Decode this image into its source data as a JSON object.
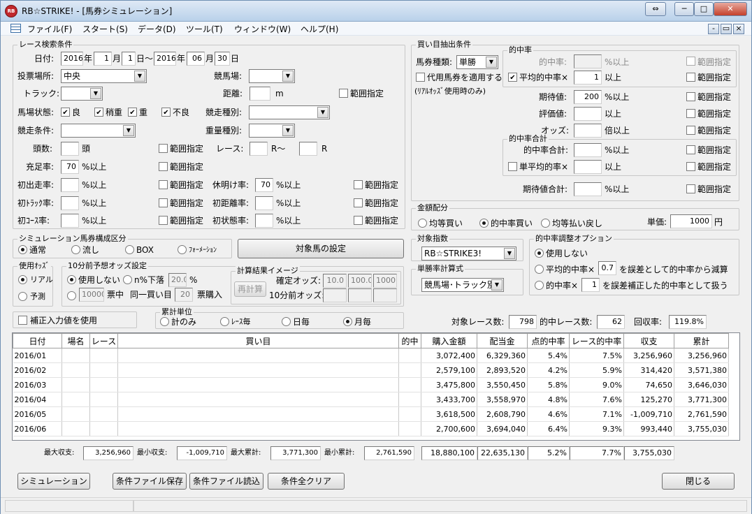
{
  "window": {
    "title": "RB☆STRIKE! - [馬券シミュレーション]",
    "logo": "RB",
    "buttons": [
      "⇔",
      "─",
      "□",
      "✕"
    ],
    "mdi_buttons": [
      "-",
      "▭",
      "×"
    ]
  },
  "menu": [
    "ファイル(F)",
    "スタート(S)",
    "データ(D)",
    "ツール(T)",
    "ウィンドウ(W)",
    "ヘルプ(H)"
  ],
  "race": {
    "title": "レース検索条件",
    "date_label": "日付:",
    "y1": "2016",
    "nen": "年",
    "m1": "1",
    "tsuki": "月",
    "d1": "1",
    "nichi_kara": "日～",
    "y2": "2016",
    "m2": "06",
    "d2": "30",
    "nichi": "日",
    "place_label": "投票場所:",
    "place": "中央",
    "course_label": "競馬場:",
    "course": "",
    "track_label": "トラック:",
    "track": "",
    "dist_label": "距離:",
    "dist": "",
    "m": "m",
    "range": "範囲指定",
    "cond_label": "馬場状態:",
    "good": "良",
    "slight": "稍重",
    "heavy": "重",
    "bad": "不良",
    "kind_label": "競走種別:",
    "kind": "",
    "race_cond_label": "競走条件:",
    "race_cond": "",
    "weight_label": "重量種別:",
    "weight": "",
    "heads_label": "頭数:",
    "heads": "",
    "tou": "頭",
    "race_label": "レース:",
    "r_from": "",
    "rkara": "R～",
    "r_to": "",
    "r": "R",
    "fill_label": "充足率:",
    "fill": "70",
    "pct_over": "%以上",
    "first_label": "初出走率:",
    "first": "",
    "rest_label": "休明け率:",
    "rest": "70",
    "firsttrack_label": "初ﾄﾗｯｸ率:",
    "firsttrack": "",
    "firstdist_label": "初距離率:",
    "firstdist": "",
    "firstcourse_label": "初ｺｰｽ率:",
    "firstcourse": "",
    "firststate_label": "初状態率:",
    "firststate": ""
  },
  "sim": {
    "title": "シミュレーション馬券構成区分",
    "opts": [
      "通常",
      "流し",
      "BOX",
      "ﾌｫｰﾒｰｼｮﾝ"
    ],
    "target_btn": "対象馬の設定"
  },
  "odds": {
    "title": "使用ｵｯｽﾞ",
    "real": "リアル",
    "pred": "予測"
  },
  "odds10": {
    "title": "10分前予想オッズ設定",
    "unused": "使用しない",
    "n_drop": "n%下落",
    "n_val": "20.0",
    "pct": "%",
    "yen": "10000",
    "hyo": "票中",
    "same": "同一買い目",
    "cnt": "20",
    "buy": "票購入"
  },
  "calc": {
    "title": "計算結果イメージ",
    "btn": "再計算",
    "fixed": "確定オッズ:",
    "f1": "10.0",
    "f2": "100.0",
    "f3": "1000",
    "ten": "10分前オッズ:"
  },
  "complement": "補正入力値を使用",
  "total": {
    "title": "累計単位",
    "opts": [
      "計のみ",
      "ﾚｰｽ毎",
      "日毎",
      "月毎"
    ]
  },
  "buy": {
    "title": "買い目抽出条件",
    "type_label": "馬券種類:",
    "type": "単勝",
    "sub": "代用馬券を適用する",
    "sub2": "(ﾘｱﾙｵｯｽﾞ使用時のみ)",
    "hit_title": "的中率",
    "hit_label": "的中率:",
    "hit_unit": "%以上",
    "avg_label": "平均的中率×",
    "avg": "1",
    "over": "以上",
    "exp_label": "期待値:",
    "exp": "200",
    "eval_label": "評価値:",
    "eval": "",
    "odds_label": "オッズ:",
    "odds_unit": "倍以上",
    "sum_title": "的中率合計",
    "sum_label": "的中率合計:",
    "sum_unit": "%以上",
    "savg_label": "単平均的率×",
    "savg": "",
    "expsum_label": "期待値合計:",
    "expsum": "",
    "range": "範囲指定"
  },
  "money": {
    "title": "金額配分",
    "opts": [
      "均等買い",
      "的中率買い",
      "均等払い戻し"
    ],
    "unit_label": "単価:",
    "unit": "1000",
    "yen": "円"
  },
  "index": {
    "title": "対象指数",
    "val": "RB☆STRIKE3!"
  },
  "adjust": {
    "title": "的中率調整オプション",
    "o1": "使用しない",
    "o2a": "平均的中率×",
    "o2v": "0.7",
    "o2b": "を誤差として的中率から減算",
    "o3a": "的中率×",
    "o3v": "1",
    "o3b": "を誤差補正した的中率として扱う"
  },
  "win_rate": {
    "title": "単勝率計算式",
    "val": "競馬場･トラック別"
  },
  "summary": {
    "races_label": "対象レース数:",
    "races": "798",
    "hits_label": "的中レース数:",
    "hits": "62",
    "recov_label": "回収率:",
    "recov": "119.8%"
  },
  "table": {
    "headers": [
      "日付",
      "場名",
      "レース",
      "買い目",
      "的中",
      "購入金額",
      "配当金",
      "点的中率",
      "レース的中率",
      "収支",
      "累計"
    ],
    "rows": [
      [
        "2016/01",
        "",
        "",
        "",
        "",
        "3,072,400",
        "6,329,360",
        "5.4%",
        "7.5%",
        "3,256,960",
        "3,256,960"
      ],
      [
        "2016/02",
        "",
        "",
        "",
        "",
        "2,579,100",
        "2,893,520",
        "4.2%",
        "5.9%",
        "314,420",
        "3,571,380"
      ],
      [
        "2016/03",
        "",
        "",
        "",
        "",
        "3,475,800",
        "3,550,450",
        "5.8%",
        "9.0%",
        "74,650",
        "3,646,030"
      ],
      [
        "2016/04",
        "",
        "",
        "",
        "",
        "3,433,700",
        "3,558,970",
        "4.8%",
        "7.6%",
        "125,270",
        "3,771,300"
      ],
      [
        "2016/05",
        "",
        "",
        "",
        "",
        "3,618,500",
        "2,608,790",
        "4.6%",
        "7.1%",
        "-1,009,710",
        "2,761,590"
      ],
      [
        "2016/06",
        "",
        "",
        "",
        "",
        "2,700,600",
        "3,694,040",
        "6.4%",
        "9.3%",
        "993,440",
        "3,755,030"
      ]
    ]
  },
  "footer": {
    "maxinc_label": "最大収支:",
    "maxinc": "3,256,960",
    "mininc_label": "最小収支:",
    "mininc": "-1,009,710",
    "maxcum_label": "最大累計:",
    "maxcum": "3,771,300",
    "mincum_label": "最小累計:",
    "mincum": "2,761,590",
    "buy": "18,880,100",
    "pay": "22,635,130",
    "hit": "5.2%",
    "rhit": "7.7%",
    "last": "3,755,030"
  },
  "buttons": {
    "sim": "シミュレーション",
    "save": "条件ファイル保存",
    "load": "条件ファイル読込",
    "clear": "条件全クリア",
    "close": "閉じる"
  }
}
